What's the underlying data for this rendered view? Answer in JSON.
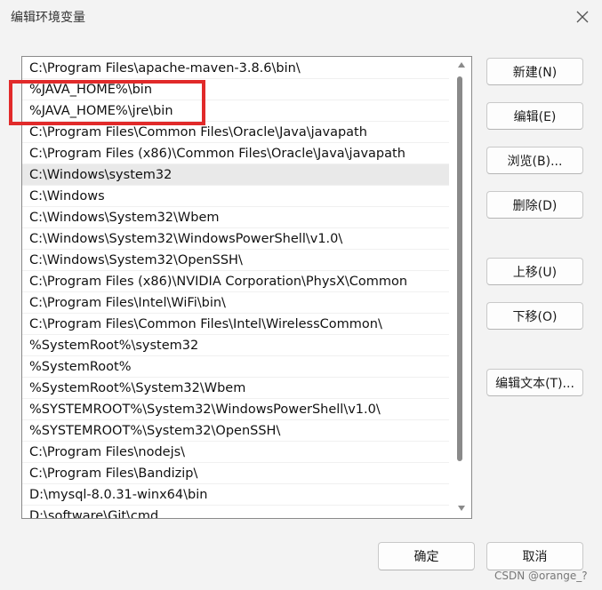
{
  "window": {
    "title": "编辑环境变量",
    "close_icon": "close-icon"
  },
  "path_list": {
    "items": [
      "C:\\Program Files\\apache-maven-3.8.6\\bin\\",
      "%JAVA_HOME%\\bin",
      "%JAVA_HOME%\\jre\\bin",
      "C:\\Program Files\\Common Files\\Oracle\\Java\\javapath",
      "C:\\Program Files (x86)\\Common Files\\Oracle\\Java\\javapath",
      "C:\\Windows\\system32",
      "C:\\Windows",
      "C:\\Windows\\System32\\Wbem",
      "C:\\Windows\\System32\\WindowsPowerShell\\v1.0\\",
      "C:\\Windows\\System32\\OpenSSH\\",
      "C:\\Program Files (x86)\\NVIDIA Corporation\\PhysX\\Common",
      "C:\\Program Files\\Intel\\WiFi\\bin\\",
      "C:\\Program Files\\Common Files\\Intel\\WirelessCommon\\",
      "%SystemRoot%\\system32",
      "%SystemRoot%",
      "%SystemRoot%\\System32\\Wbem",
      "%SYSTEMROOT%\\System32\\WindowsPowerShell\\v1.0\\",
      "%SYSTEMROOT%\\System32\\OpenSSH\\",
      "C:\\Program Files\\nodejs\\",
      "C:\\Program Files\\Bandizip\\",
      "D:\\mysql-8.0.31-winx64\\bin",
      "D:\\software\\Git\\cmd"
    ],
    "selected_item": "C:\\Windows\\system32",
    "highlight_color": "#e12a2a"
  },
  "buttons": {
    "new": "新建(N)",
    "edit": "编辑(E)",
    "browse": "浏览(B)...",
    "delete": "删除(D)",
    "move_up": "上移(U)",
    "move_down": "下移(O)",
    "edit_text": "编辑文本(T)...",
    "ok": "确定",
    "cancel": "取消"
  },
  "watermark": "CSDN @orange_?"
}
